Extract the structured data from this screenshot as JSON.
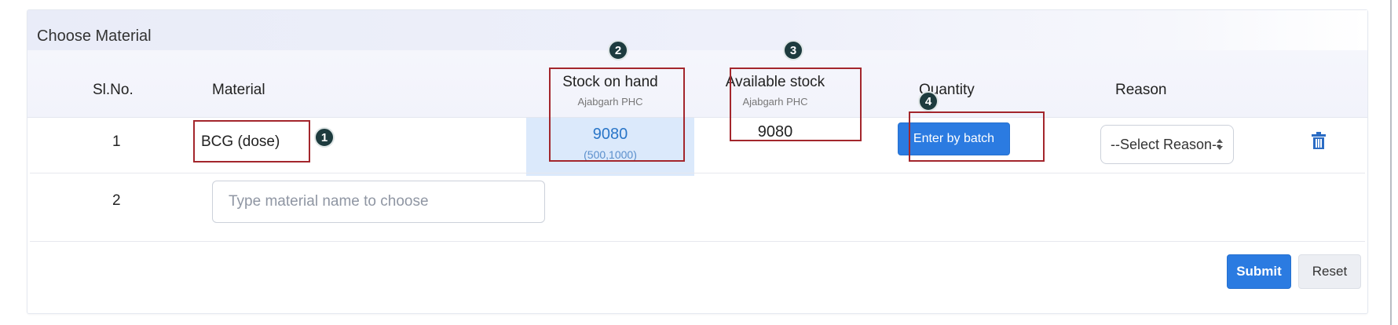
{
  "panel": {
    "title": "Choose Material"
  },
  "table": {
    "headers": {
      "slno": "Sl.No.",
      "material": "Material",
      "stock_on_hand": "Stock on hand",
      "stock_on_hand_sub": "Ajabgarh PHC",
      "available_stock": "Available stock",
      "available_stock_sub": "Ajabgarh PHC",
      "quantity": "Quantity",
      "reason": "Reason"
    },
    "rows": [
      {
        "slno": "1",
        "material": "BCG (dose)",
        "stock_on_hand": "9080",
        "stock_range": "(500,1000)",
        "available_stock": "9080",
        "quantity_button": "Enter by batch",
        "reason_select": "--Select Reason--"
      },
      {
        "slno": "2",
        "material_placeholder": "Type material name to choose"
      }
    ]
  },
  "actions": {
    "submit": "Submit",
    "reset": "Reset"
  },
  "badges": [
    "1",
    "2",
    "3",
    "4"
  ],
  "colors": {
    "primary": "#2b7be1",
    "highlight": "#a3262c",
    "badge": "#1d3b3e",
    "stock_cell": "#dbe9fb"
  }
}
